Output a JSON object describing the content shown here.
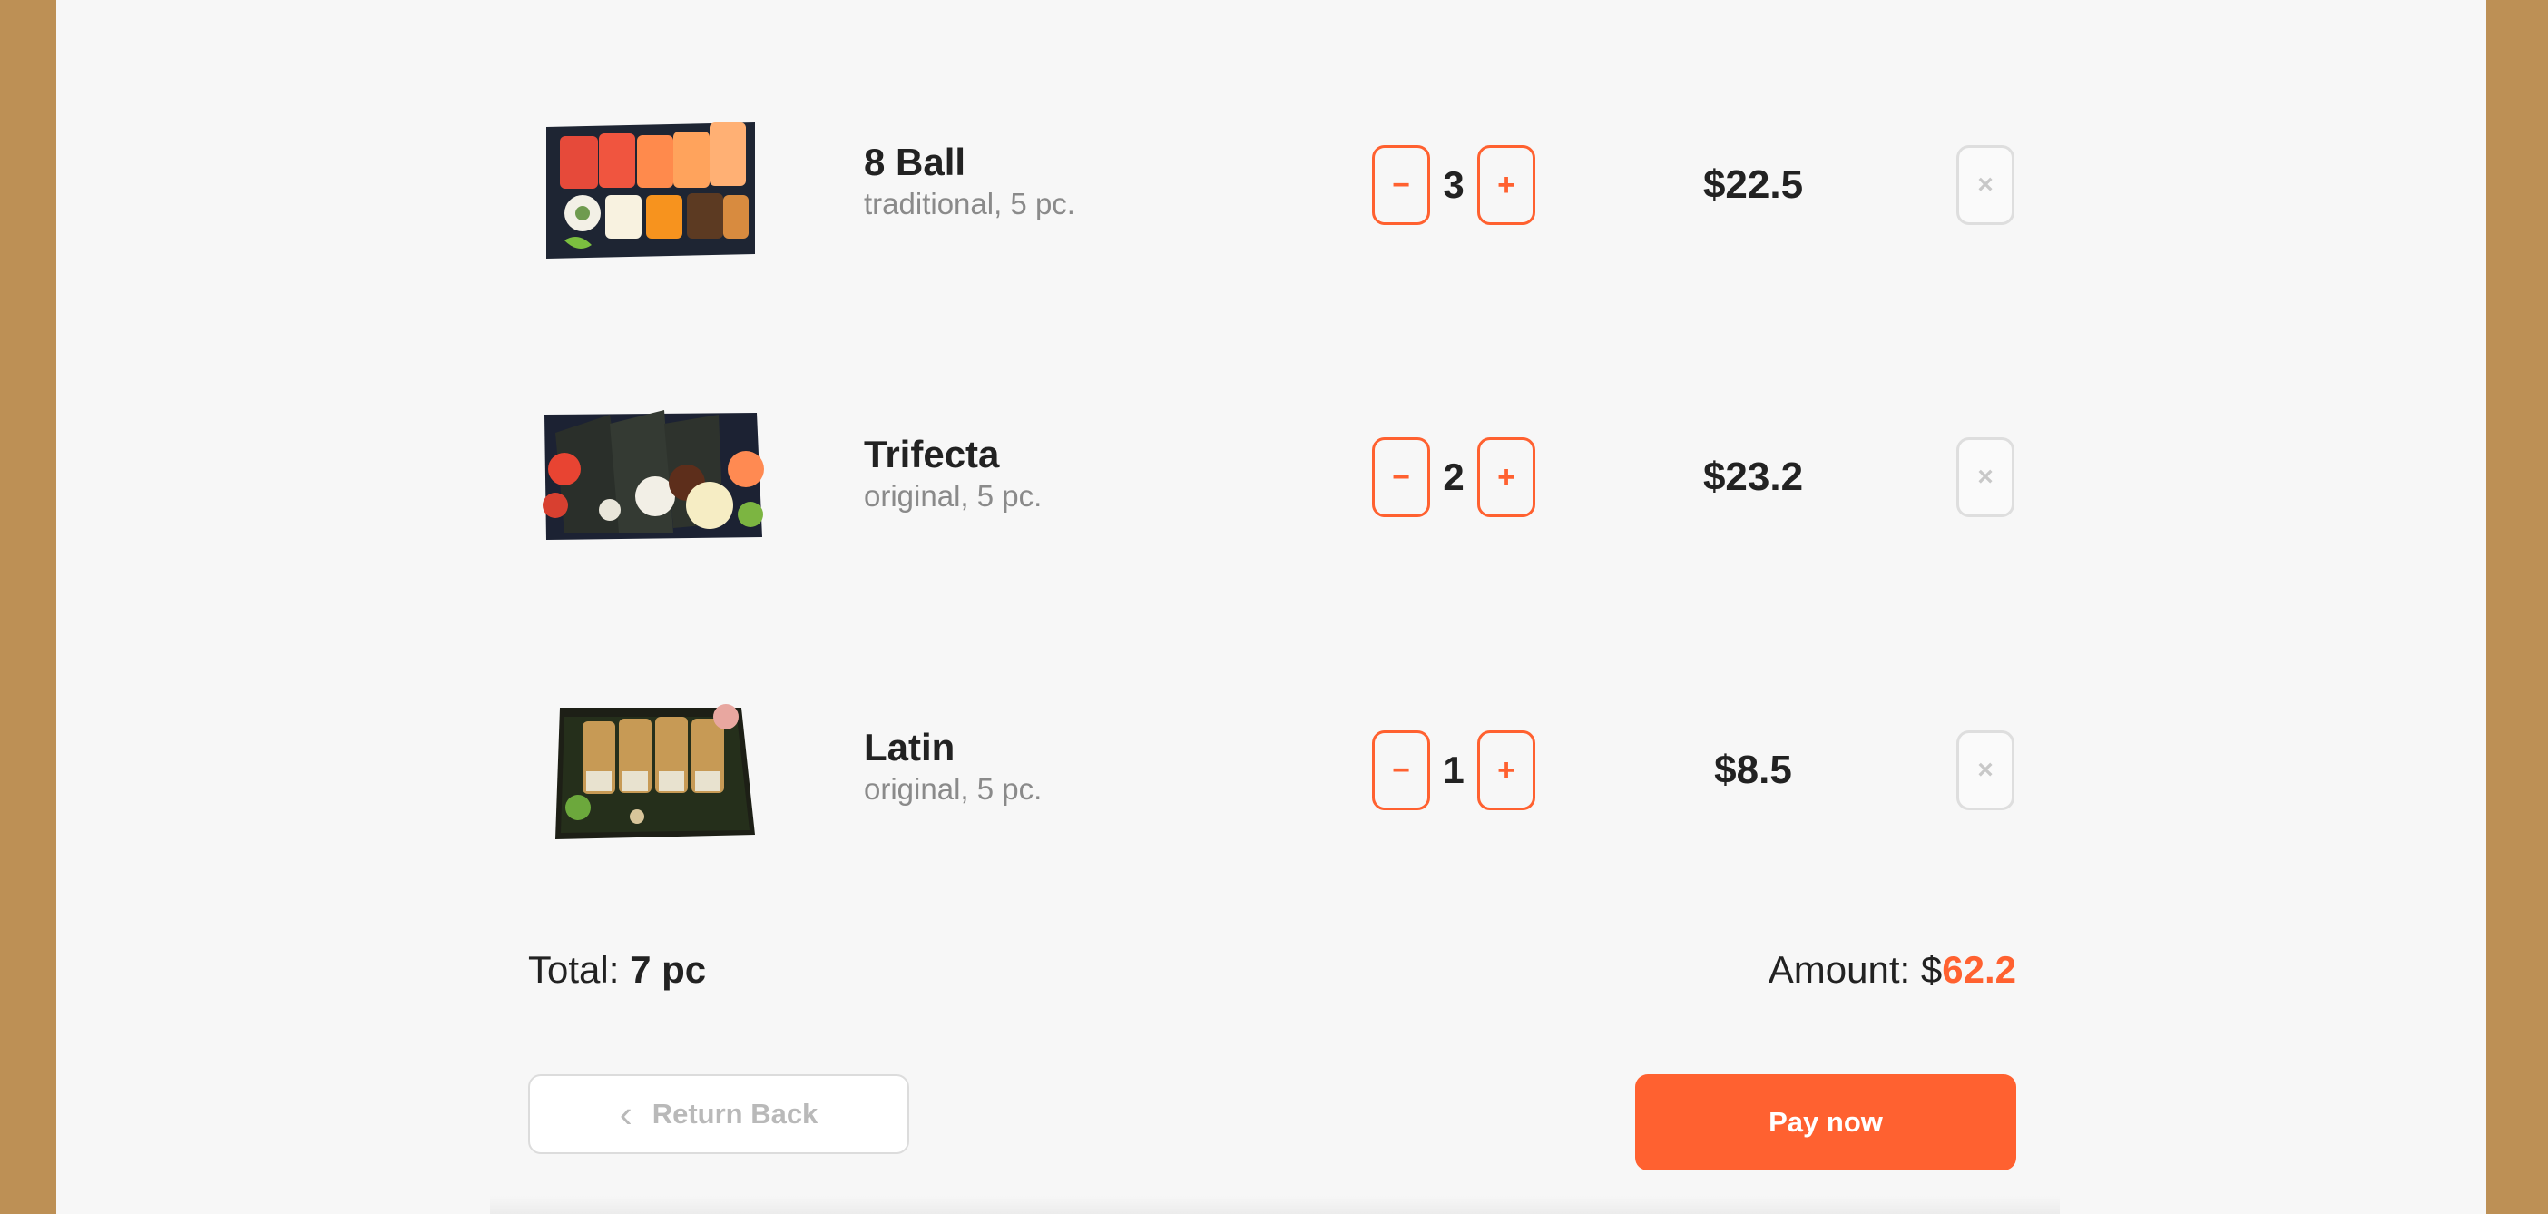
{
  "cart": {
    "items": [
      {
        "name": "8 Ball",
        "desc": "traditional, 5 pc.",
        "qty": "3",
        "price": "$22.5",
        "minus": "−",
        "plus": "+",
        "remove": "×"
      },
      {
        "name": "Trifecta",
        "desc": "original, 5 pc.",
        "qty": "2",
        "price": "$23.2",
        "minus": "−",
        "plus": "+",
        "remove": "×"
      },
      {
        "name": "Latin",
        "desc": "original, 5 pc.",
        "qty": "1",
        "price": "$8.5",
        "minus": "−",
        "plus": "+",
        "remove": "×"
      }
    ]
  },
  "summary": {
    "total_label": "Total:",
    "total_value": "7 pc",
    "amount_label": "Amount: $",
    "amount_value": "62.2"
  },
  "actions": {
    "back_label": "Return Back",
    "back_icon": "‹",
    "pay_label": "Pay now"
  },
  "colors": {
    "accent": "#ff6130",
    "background_frame": "#bd9055",
    "panel": "#f7f7f7"
  }
}
